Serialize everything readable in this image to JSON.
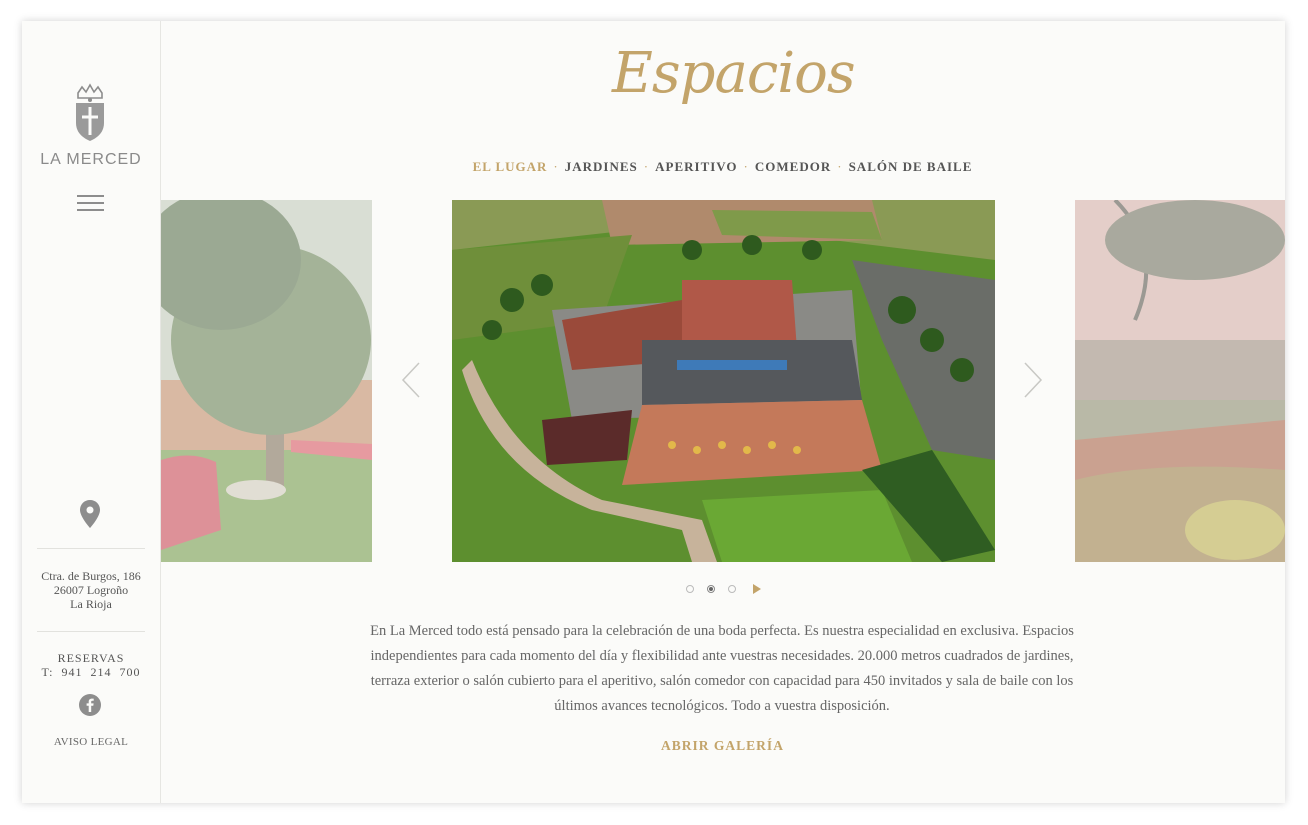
{
  "brand": {
    "name": "LA MERCED",
    "crest_icon": "crest-icon"
  },
  "sidebar": {
    "menu_icon": "hamburger-menu-icon",
    "location_icon": "map-pin-icon",
    "address": [
      "Ctra. de Burgos, 186",
      "26007 Logroño",
      "La Rioja"
    ],
    "reservas_label": "RESERVAS",
    "phone": "T:  941  214  700",
    "social_icon": "facebook-icon",
    "legal_link": "AVISO LEGAL"
  },
  "header": {
    "title": "Espacios",
    "nav": [
      {
        "label": "EL LUGAR",
        "active": true
      },
      {
        "label": "JARDINES",
        "active": false
      },
      {
        "label": "APERITIVO",
        "active": false
      },
      {
        "label": "COMEDOR",
        "active": false
      },
      {
        "label": "SALÓN DE BAILE",
        "active": false
      }
    ],
    "separator": "·"
  },
  "carousel": {
    "prev_icon": "chevron-left-icon",
    "next_icon": "chevron-right-icon",
    "slide_count": 3,
    "active_index": 1,
    "play_icon": "play-icon"
  },
  "content": {
    "description": "En La Merced todo está pensado para la celebración de una boda perfecta. Es nuestra especialidad en exclusiva. Espacios independientes para cada momento del día y flexibilidad ante vuestras necesidades. 20.000 metros cuadrados de jardines, terraza exterior o salón cubierto para el aperitivo, salón comedor con capacidad para 450 invitados y sala de baile con los últimos avances tecnológicos. Todo a vuestra disposición.",
    "gallery_link": "ABRIR GALERÍA"
  },
  "colors": {
    "accent": "#c3a46a",
    "text": "#555555",
    "background": "#fbfbf9"
  }
}
